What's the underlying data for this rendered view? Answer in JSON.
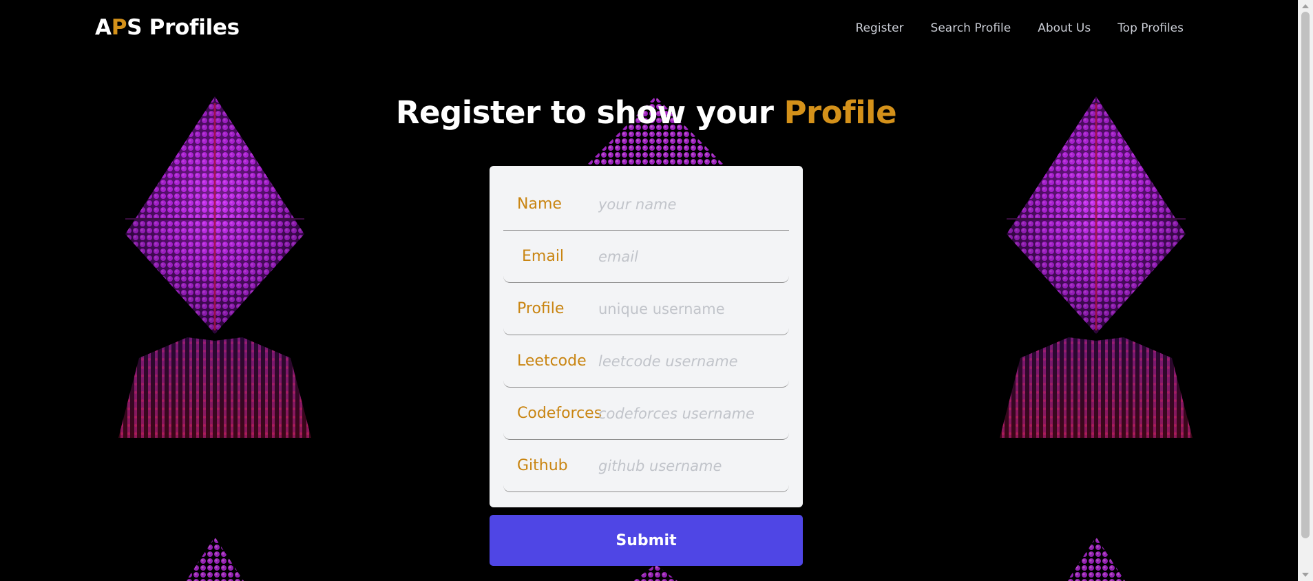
{
  "app": {
    "brand_a": "A",
    "brand_p": "P",
    "brand_rest": "S Profiles"
  },
  "nav": {
    "items": [
      {
        "label": "Register"
      },
      {
        "label": "Search Profile"
      },
      {
        "label": "About Us"
      },
      {
        "label": "Top Profiles"
      }
    ]
  },
  "heading": {
    "main": "Register to show your ",
    "accent": "Profile"
  },
  "form": {
    "fields": [
      {
        "label": "Name",
        "value": "",
        "placeholder": "your name"
      },
      {
        "label": "Email",
        "value": "",
        "placeholder": "email"
      },
      {
        "label": "Profile",
        "value": "",
        "placeholder": "unique username"
      },
      {
        "label": "Leetcode",
        "value": "",
        "placeholder": "leetcode username"
      },
      {
        "label": "Codeforces",
        "value": "",
        "placeholder": "codeforces username"
      },
      {
        "label": "Github",
        "value": "",
        "placeholder": "github username"
      }
    ],
    "submit_label": "Submit"
  },
  "colors": {
    "accent": "#d4911a",
    "label": "#c98512",
    "button": "#4f46e5",
    "background": "#000000",
    "card": "#f3f4f6"
  }
}
